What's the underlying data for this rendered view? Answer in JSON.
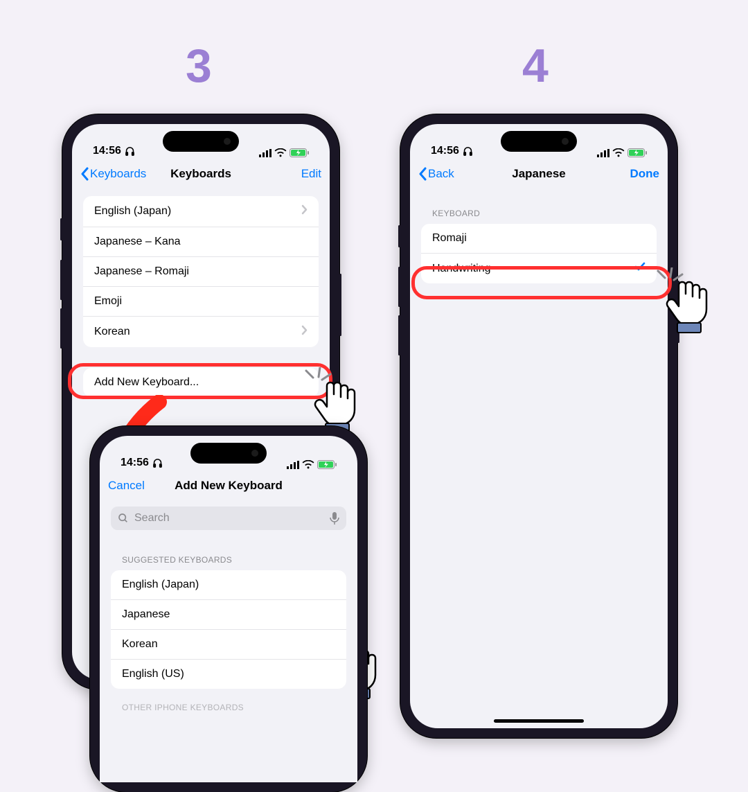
{
  "steps": {
    "s3": "3",
    "s4": "4"
  },
  "status": {
    "time": "14:56"
  },
  "phone3": {
    "nav": {
      "back": "Keyboards",
      "title": "Keyboards",
      "right": "Edit"
    },
    "rows": [
      {
        "label": "English (Japan)",
        "chev": true
      },
      {
        "label": "Japanese – Kana"
      },
      {
        "label": "Japanese – Romaji"
      },
      {
        "label": "Emoji"
      },
      {
        "label": "Korean",
        "chev": true
      }
    ],
    "add_label": "Add New Keyboard..."
  },
  "phone3b": {
    "nav": {
      "left": "Cancel",
      "title": "Add New Keyboard"
    },
    "search_placeholder": "Search",
    "section1_header": "SUGGESTED KEYBOARDS",
    "rows": [
      {
        "label": "English (Japan)"
      },
      {
        "label": "Japanese"
      },
      {
        "label": "Korean"
      },
      {
        "label": "English (US)"
      }
    ],
    "section2_header": "OTHER IPHONE KEYBOARDS"
  },
  "phone4": {
    "nav": {
      "back": "Back",
      "title": "Japanese",
      "right": "Done"
    },
    "section_header": "KEYBOARD",
    "rows": [
      {
        "label": "Romaji"
      },
      {
        "label": "Handwriting",
        "checked": true
      }
    ]
  }
}
